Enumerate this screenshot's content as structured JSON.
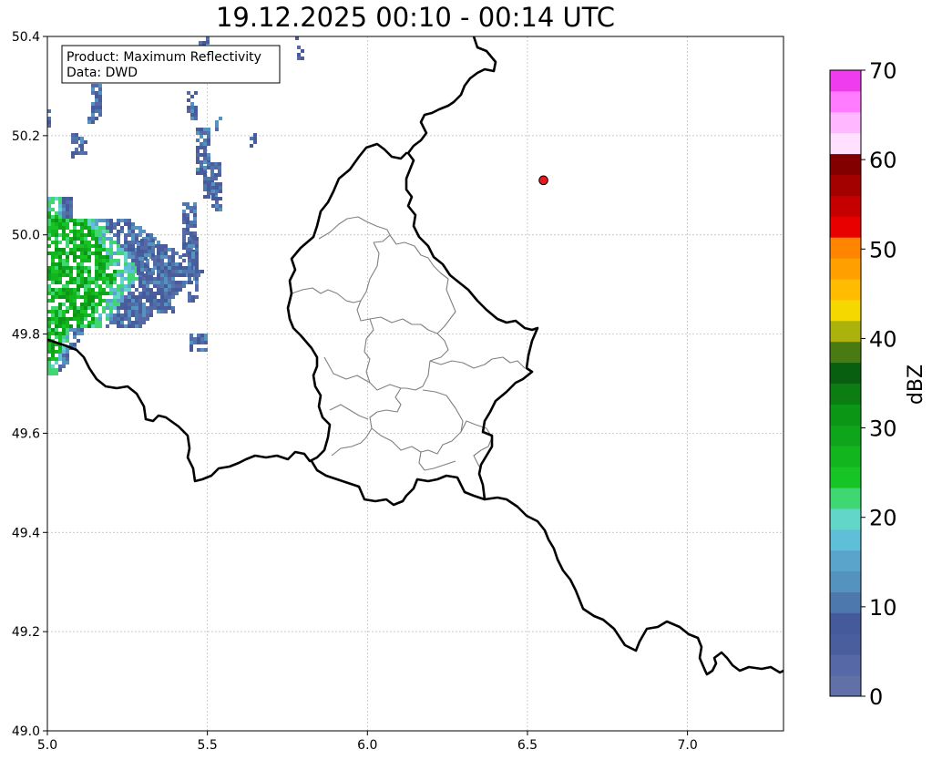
{
  "title": "19.12.2025 00:10 - 00:14 UTC",
  "info_box": {
    "line1": "Product: Maximum Reflectivity",
    "line2": "Data: DWD"
  },
  "map": {
    "x_ticks": [
      "5.0",
      "5.5",
      "6.0",
      "6.5",
      "7.0"
    ],
    "y_ticks": [
      "50.4",
      "50.2",
      "50.0",
      "49.8",
      "49.6",
      "49.4",
      "49.2",
      "49.0"
    ],
    "x_range": [
      5.0,
      7.3
    ],
    "y_range": [
      49.0,
      50.4
    ],
    "grid": true,
    "marker": {
      "lon": 6.55,
      "lat": 50.11,
      "color": "#e41a1c"
    }
  },
  "colorbar": {
    "label": "dBZ",
    "ticks": [
      "0",
      "10",
      "20",
      "30",
      "40",
      "50",
      "60",
      "70"
    ],
    "range": [
      0,
      70
    ],
    "colors": [
      "#6270a8",
      "#5768a6",
      "#4a5e9e",
      "#455a9a",
      "#4d78ad",
      "#5492c0",
      "#5aa4cc",
      "#5fbed8",
      "#62d6c8",
      "#3ed771",
      "#16c426",
      "#12b51e",
      "#0fa51a",
      "#0c9616",
      "#0b7d13",
      "#095f10",
      "#4a7a12",
      "#aab20b",
      "#f5d800",
      "#ffbc00",
      "#ffa000",
      "#ff8400",
      "#e80000",
      "#c50000",
      "#a30000",
      "#820000",
      "#ffe0ff",
      "#ffb8ff",
      "#ff7bff",
      "#ee3cee"
    ]
  },
  "colors": {
    "country_border": "#000000",
    "district_border": "#808080",
    "grid": "#b8b8b8"
  }
}
